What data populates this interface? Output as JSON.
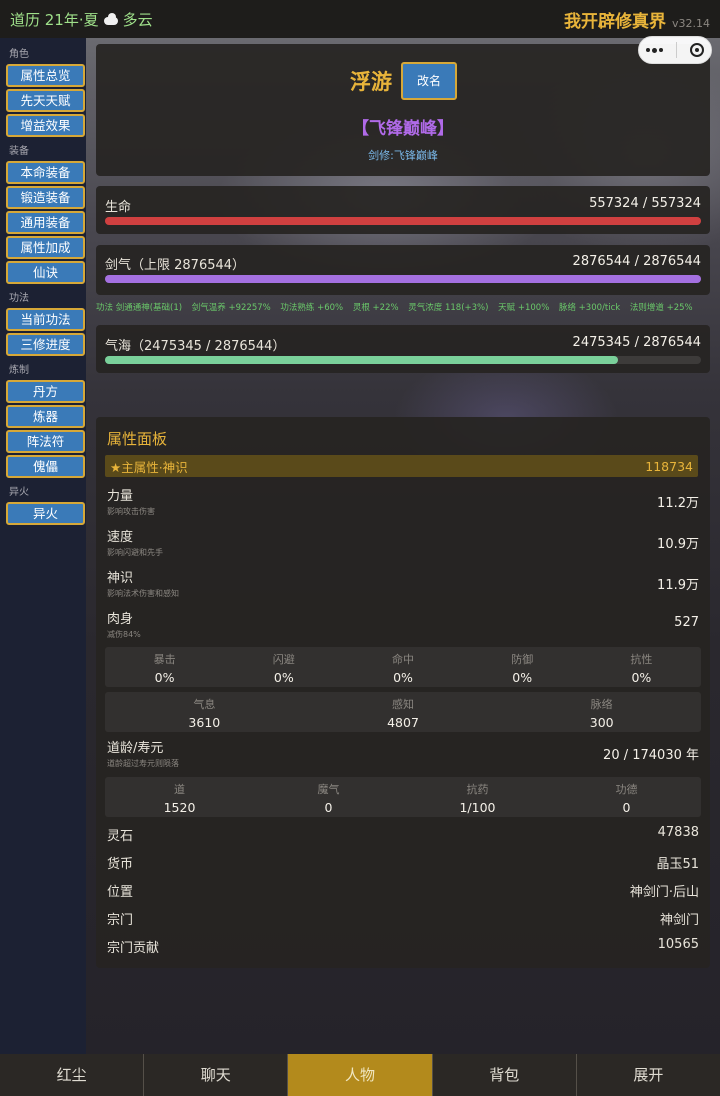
{
  "topbar": {
    "calendar": "道历 21年·夏",
    "weather": "多云",
    "weather_icon": "cloud-icon",
    "app_title": "我开辟修真界",
    "version": "v32.14"
  },
  "sidebar": {
    "groups": [
      {
        "label": "角色",
        "items": [
          "属性总览",
          "先天天赋",
          "增益效果"
        ]
      },
      {
        "label": "装备",
        "items": [
          "本命装备",
          "锻造装备",
          "通用装备",
          "属性加成",
          "仙诀"
        ]
      },
      {
        "label": "功法",
        "items": [
          "当前功法",
          "三修进度"
        ]
      },
      {
        "label": "炼制",
        "items": [
          "丹方",
          "炼器",
          "阵法符",
          "傀儡"
        ]
      },
      {
        "label": "异火",
        "items": [
          "异火"
        ]
      }
    ]
  },
  "character": {
    "name": "浮游",
    "rename_label": "改名",
    "title": "【飞锋巅峰】",
    "subtitle": "剑修:飞锋巅峰"
  },
  "bars": {
    "life": {
      "label": "生命",
      "value": "557324 / 557324",
      "fraction": 1.0,
      "color": "#d04040"
    },
    "sword": {
      "label": "剑气（上限 2876544）",
      "value": "2876544 / 2876544",
      "fraction": 1.0,
      "color": "#a470e0"
    },
    "qi": {
      "label": "气海（2475345 / 2876544）",
      "value": "2475345 / 2876544",
      "fraction": 0.8605,
      "color": "#7ad09a"
    }
  },
  "buffs": [
    "功法 剑通通神(基础(1)",
    "剑气温养 +92257%",
    "功法熟练 +60%",
    "灵根 +22%",
    "灵气浓度 118(+3%)",
    "天赋 +100%",
    "脉络 +300/tick",
    "法则增道 +25%"
  ],
  "attributes": {
    "panel_title": "属性面板",
    "main_label": "★主属性·神识",
    "main_value": "118734",
    "stats": [
      {
        "name": "力量",
        "desc": "影响攻击伤害",
        "value": "11.2万"
      },
      {
        "name": "速度",
        "desc": "影响闪避和先手",
        "value": "10.9万"
      },
      {
        "name": "神识",
        "desc": "影响法术伤害和感知",
        "value": "11.9万"
      },
      {
        "name": "肉身",
        "desc": "减伤84%",
        "value": "527"
      }
    ],
    "combat": [
      {
        "h": "暴击",
        "v": "0%"
      },
      {
        "h": "闪避",
        "v": "0%"
      },
      {
        "h": "命中",
        "v": "0%"
      },
      {
        "h": "防御",
        "v": "0%"
      },
      {
        "h": "抗性",
        "v": "0%"
      }
    ],
    "inner": [
      {
        "h": "气息",
        "v": "3610"
      },
      {
        "h": "感知",
        "v": "4807"
      },
      {
        "h": "脉络",
        "v": "300"
      }
    ],
    "age": {
      "name": "道龄/寿元",
      "desc": "道龄超过寿元则陨落",
      "value": "20 / 174030 年"
    },
    "dao": [
      {
        "h": "道",
        "v": "1520"
      },
      {
        "h": "魔气",
        "v": "0"
      },
      {
        "h": "抗药",
        "v": "1/100"
      },
      {
        "h": "功德",
        "v": "0"
      }
    ],
    "info": [
      {
        "k": "灵石",
        "v": "47838"
      },
      {
        "k": "货币",
        "v": "晶玉51"
      },
      {
        "k": "位置",
        "v": "神剑门·后山"
      },
      {
        "k": "宗门",
        "v": "神剑门"
      },
      {
        "k": "宗门贡献",
        "v": "10565"
      }
    ]
  },
  "tabs": [
    "红尘",
    "聊天",
    "人物",
    "背包",
    "展开"
  ],
  "active_tab": "人物"
}
